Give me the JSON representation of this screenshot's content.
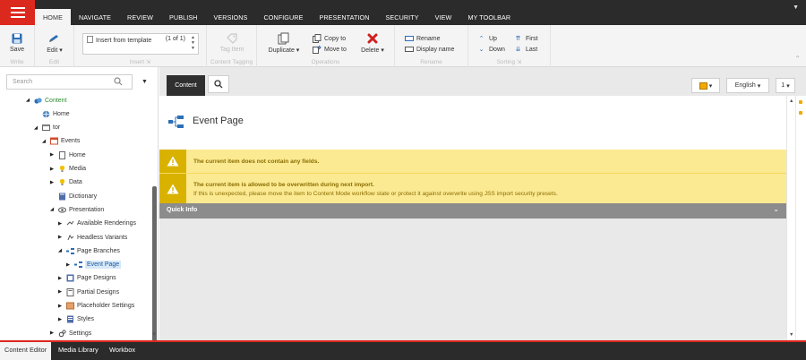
{
  "topbar": {
    "tabs": [
      "HOME",
      "NAVIGATE",
      "REVIEW",
      "PUBLISH",
      "VERSIONS",
      "CONFIGURE",
      "PRESENTATION",
      "SECURITY",
      "VIEW",
      "MY TOOLBAR"
    ],
    "active_tab": "HOME"
  },
  "ribbon": {
    "write": {
      "save": "Save",
      "label": "Write"
    },
    "edit": {
      "edit": "Edit",
      "label": "Edit"
    },
    "insert": {
      "value": "Insert from template",
      "page": "(1 of 1)",
      "label": "Insert"
    },
    "content_tagging": {
      "tag_item": "Tag Item",
      "label": "Content Tagging"
    },
    "operations": {
      "duplicate": "Duplicate",
      "copy_to": "Copy to",
      "move_to": "Move to",
      "delete": "Delete",
      "label": "Operations"
    },
    "rename": {
      "rename": "Rename",
      "display_name": "Display name",
      "label": "Rename"
    },
    "sorting": {
      "up": "Up",
      "down": "Down",
      "first": "First",
      "last": "Last",
      "label": "Sorting"
    }
  },
  "search": {
    "placeholder": "Search"
  },
  "tree": [
    {
      "label": "Content",
      "level": 0,
      "arrow": "open",
      "icon": "content-icon",
      "green": true
    },
    {
      "label": "Home",
      "level": 1,
      "arrow": "",
      "icon": "home-globe-icon"
    },
    {
      "label": "tor",
      "level": 1,
      "arrow": "open",
      "icon": "site-icon"
    },
    {
      "label": "Events",
      "level": 2,
      "arrow": "open",
      "icon": "events-icon"
    },
    {
      "label": "Home",
      "level": 3,
      "arrow": "closed",
      "icon": "page-icon"
    },
    {
      "label": "Media",
      "level": 3,
      "arrow": "closed",
      "icon": "media-icon"
    },
    {
      "label": "Data",
      "level": 3,
      "arrow": "closed",
      "icon": "data-icon"
    },
    {
      "label": "Dictionary",
      "level": 3,
      "arrow": "",
      "icon": "dictionary-icon"
    },
    {
      "label": "Presentation",
      "level": 3,
      "arrow": "open",
      "icon": "presentation-icon"
    },
    {
      "label": "Available Renderings",
      "level": 4,
      "arrow": "closed",
      "icon": "renderings-icon"
    },
    {
      "label": "Headless Variants",
      "level": 4,
      "arrow": "closed",
      "icon": "variants-icon"
    },
    {
      "label": "Page Branches",
      "level": 4,
      "arrow": "open",
      "icon": "branches-icon"
    },
    {
      "label": "Event Page",
      "level": 5,
      "arrow": "closed",
      "icon": "event-page-icon",
      "selected": true
    },
    {
      "label": "Page Designs",
      "level": 4,
      "arrow": "closed",
      "icon": "page-designs-icon"
    },
    {
      "label": "Partial Designs",
      "level": 4,
      "arrow": "closed",
      "icon": "partial-designs-icon"
    },
    {
      "label": "Placeholder Settings",
      "level": 4,
      "arrow": "closed",
      "icon": "placeholder-icon"
    },
    {
      "label": "Styles",
      "level": 4,
      "arrow": "closed",
      "icon": "styles-icon"
    },
    {
      "label": "Settings",
      "level": 3,
      "arrow": "closed",
      "icon": "settings-icon"
    }
  ],
  "content": {
    "tab": "Content",
    "language": "English",
    "version": "1",
    "title": "Event Page",
    "warnings": [
      {
        "lines": [
          "The current item does not contain any fields."
        ]
      },
      {
        "lines": [
          "The current item is allowed to be overwritten during next import.",
          "If this is unexpected, please move the item to Content Mode workflow state or protect it against overwrite using JSS import security presets."
        ]
      }
    ],
    "quick_info": "Quick Info"
  },
  "bottom_tabs": [
    "Content Editor",
    "Media Library",
    "Workbox"
  ],
  "colors": {
    "accent": "#dc291e",
    "dark": "#2b2b2b",
    "warning_bg": "#fcea92",
    "warning_icon": "#d9b200"
  }
}
